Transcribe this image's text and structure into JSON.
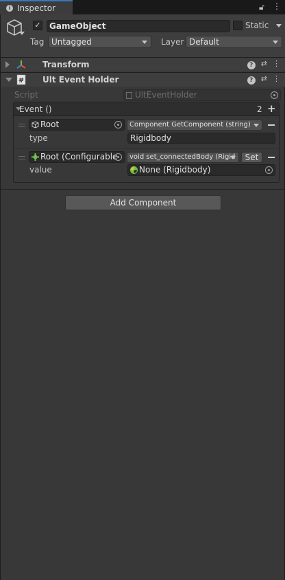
{
  "tab": {
    "title": "Inspector",
    "icon": "info-icon"
  },
  "header": {
    "active": true,
    "name": "GameObject",
    "static_label": "Static",
    "static_checked": false,
    "tag_label": "Tag",
    "tag_value": "Untagged",
    "layer_label": "Layer",
    "layer_value": "Default"
  },
  "components": [
    {
      "title": "Transform",
      "expanded": false,
      "icon": "transform-axes-icon"
    },
    {
      "title": "Ult Event Holder",
      "expanded": true,
      "icon": "csharp-script-icon"
    }
  ],
  "script": {
    "label": "Script",
    "value": "UltEventHolder"
  },
  "event": {
    "title": "Event ()",
    "count": "2",
    "entries": [
      {
        "target": "Root",
        "method": "Component GetComponent (string)",
        "arg_label": "type",
        "arg_value": "Rigidbody"
      },
      {
        "target": "Root (Configurable",
        "method": "void set_connectedBody (Rigid",
        "set_label": "Set",
        "arg_label": "value",
        "arg_value": "None (Rigidbody)"
      }
    ]
  },
  "add_component_label": "Add Component",
  "colors": {
    "accent": "#3a79bb",
    "panel": "#383838",
    "header": "#3e3e3e"
  }
}
